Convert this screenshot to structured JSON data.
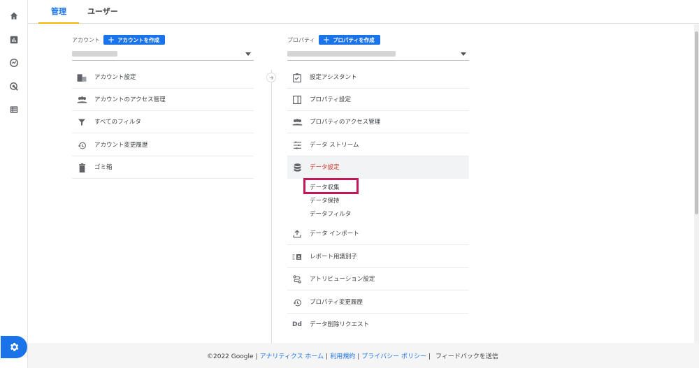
{
  "tabs": [
    {
      "label": "管理"
    },
    {
      "label": "ユーザー"
    }
  ],
  "rail": {
    "icons": [
      "home-icon",
      "reports-icon",
      "explore-icon",
      "advertising-icon",
      "list-icon"
    ],
    "settings_icon": "gear-icon"
  },
  "account": {
    "label": "アカウント",
    "create_button": "アカウントを作成",
    "items": [
      {
        "label": "アカウント設定",
        "icon": "building-icon"
      },
      {
        "label": "アカウントのアクセス管理",
        "icon": "people-icon"
      },
      {
        "label": "すべてのフィルタ",
        "icon": "filter-icon"
      },
      {
        "label": "アカウント変更履歴",
        "icon": "history-icon"
      },
      {
        "label": "ゴミ箱",
        "icon": "trash-icon"
      }
    ]
  },
  "property": {
    "label": "プロパティ",
    "create_button": "プロパティを作成",
    "items": [
      {
        "label": "設定アシスタント",
        "icon": "checklist-icon"
      },
      {
        "label": "プロパティ設定",
        "icon": "layout-icon"
      },
      {
        "label": "プロパティのアクセス管理",
        "icon": "people-icon"
      },
      {
        "label": "データ ストリーム",
        "icon": "streams-icon"
      },
      {
        "label": "データ設定",
        "icon": "database-icon"
      }
    ],
    "data_settings_sub": [
      "データ収集",
      "データ保持",
      "データフィルタ"
    ],
    "items_after": [
      {
        "label": "データ インポート",
        "icon": "upload-icon"
      },
      {
        "label": "レポート用識別子",
        "icon": "identifier-icon"
      },
      {
        "label": "アトリビューション設定",
        "icon": "attribution-icon"
      },
      {
        "label": "プロパティ変更履歴",
        "icon": "history-icon"
      },
      {
        "label": "データ削除リクエスト",
        "icon": "dd-icon"
      }
    ]
  },
  "footer": {
    "copyright": "©2022 Google",
    "links": [
      "アナリティクス ホーム",
      "利用規約",
      "プライバシー ポリシー"
    ],
    "feedback": "フィードバックを送信"
  },
  "colors": {
    "accent": "#1a73e8",
    "tab_underline": "#f4b400",
    "active_item": "#d93025",
    "highlight_box": "#c2185b"
  }
}
